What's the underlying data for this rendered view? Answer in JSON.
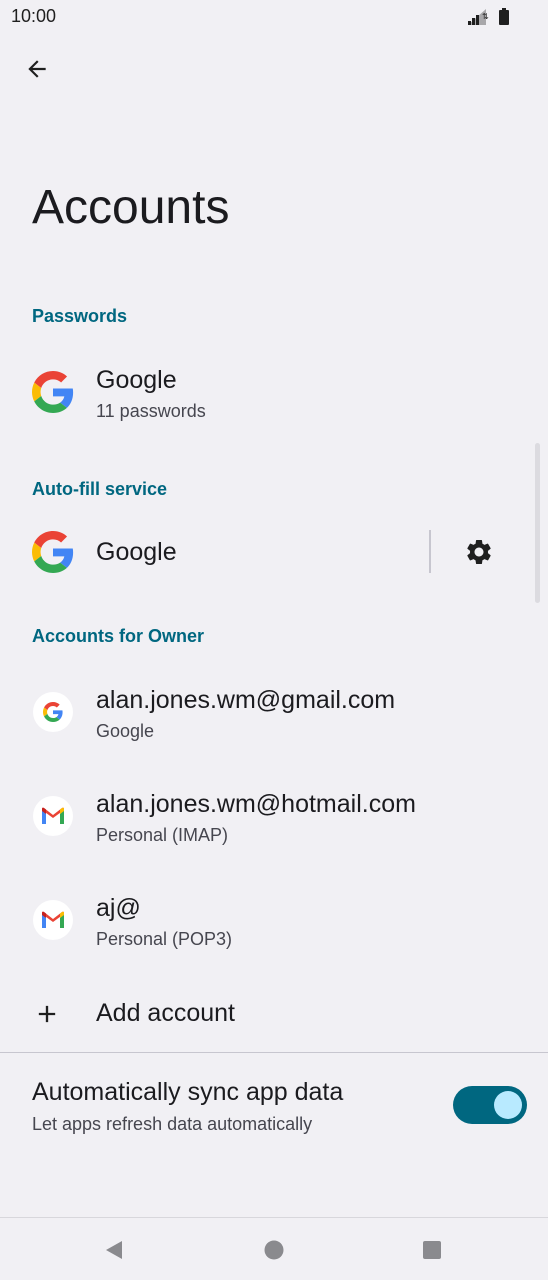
{
  "status_bar": {
    "time": "10:00"
  },
  "header": {
    "title": "Accounts"
  },
  "passwords": {
    "section_title": "Passwords",
    "item": {
      "title": "Google",
      "subtitle": "11 passwords"
    }
  },
  "autofill": {
    "section_title": "Auto-fill service",
    "item": {
      "title": "Google"
    }
  },
  "accounts": {
    "section_title": "Accounts for Owner",
    "items": [
      {
        "title": "alan.jones.wm@gmail.com",
        "subtitle": "Google",
        "icon": "google-icon"
      },
      {
        "title": "alan.jones.wm@hotmail.com",
        "subtitle": "Personal (IMAP)",
        "icon": "gmail-icon"
      },
      {
        "title": "aj@",
        "subtitle": "Personal (POP3)",
        "icon": "gmail-icon"
      }
    ],
    "add_label": "Add account"
  },
  "sync": {
    "title": "Automatically sync app data",
    "subtitle": "Let apps refresh data automatically",
    "enabled": true
  },
  "colors": {
    "accent": "#006780",
    "background": "#f1f0f4",
    "toggle_knob": "#b8eaff"
  }
}
